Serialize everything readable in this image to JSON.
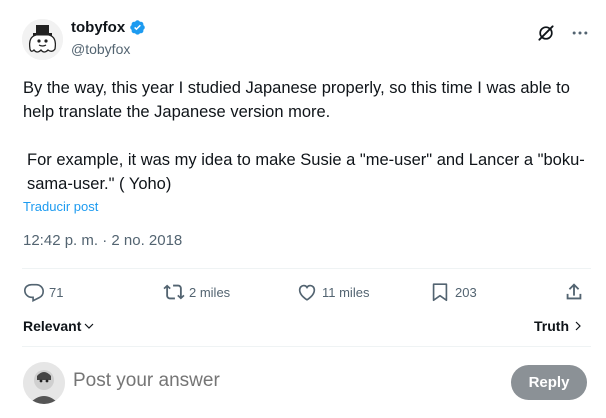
{
  "author": {
    "display_name": "tobyfox",
    "handle": "@tobyfox",
    "verified": true
  },
  "post": {
    "paragraph_1": "By the way, this year I studied Japanese properly, so this time I was able to help translate the Japanese version more.",
    "paragraph_2": "For example, it was my idea to make Susie a \"me-user\" and Lancer a \"boku-sama-user.\" ( Yoho)",
    "translate_label": "Traducir post",
    "timestamp": "12:42 p. m. · 2 no. 2018"
  },
  "actions": {
    "replies": "71",
    "reposts": "2 miles",
    "likes": "11 miles",
    "bookmarks": "203"
  },
  "sort": {
    "left_label": "Relevant",
    "right_label": "Truth"
  },
  "reply": {
    "placeholder": "Post your answer",
    "button_label": "Reply"
  },
  "colors": {
    "accent": "#1d9bf0",
    "text_primary": "#0f1419",
    "text_secondary": "#536471",
    "reply_button_disabled": "#8b9196"
  },
  "icons": [
    "avatar-ghost",
    "verified-badge-icon",
    "grok-icon",
    "more-icon",
    "reply-icon",
    "repost-icon",
    "like-icon",
    "bookmark-icon",
    "share-icon",
    "chevron-down-icon",
    "chevron-right-icon"
  ]
}
